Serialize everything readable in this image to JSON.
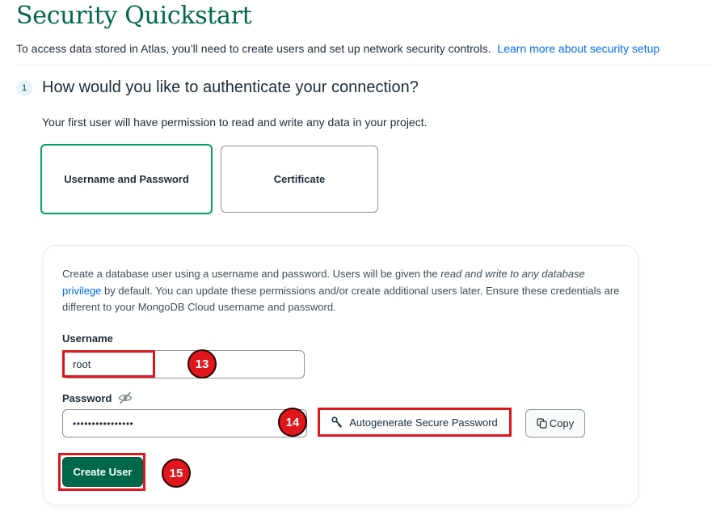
{
  "header": {
    "title": "Security Quickstart",
    "intro_text": "To access data stored in Atlas, you’ll need to create users and set up network security controls.",
    "intro_link": "Learn more about security setup"
  },
  "step": {
    "number": "1",
    "heading": "How would you like to authenticate your connection?",
    "subtext": "Your first user will have permission to read and write any data in your project."
  },
  "auth_options": {
    "username_password": "Username and Password",
    "certificate": "Certificate",
    "selected": "Username and Password"
  },
  "form": {
    "desc_part1": "Create a database user using a username and password. Users will be given the ",
    "desc_italic": "read and write to any database",
    "desc_link": "privilege",
    "desc_part2": " by default. You can update these permissions and/or create additional users later. Ensure these credentials are different to your MongoDB Cloud username and password.",
    "username_label": "Username",
    "username_value": "root",
    "password_label": "Password",
    "password_value": "••••••••••••••••",
    "autogen_label": "Autogenerate Secure Password",
    "copy_label": "Copy",
    "create_label": "Create User"
  },
  "annotations": {
    "marker_13": "13",
    "marker_14": "14",
    "marker_15": "15"
  },
  "colors": {
    "brand_green": "#00684a",
    "selected_border": "#00a35c",
    "link_blue": "#016bf8",
    "annotation_red": "#e0161d"
  },
  "icons": [
    "key-icon",
    "copy-icon",
    "eye-slash-icon"
  ]
}
